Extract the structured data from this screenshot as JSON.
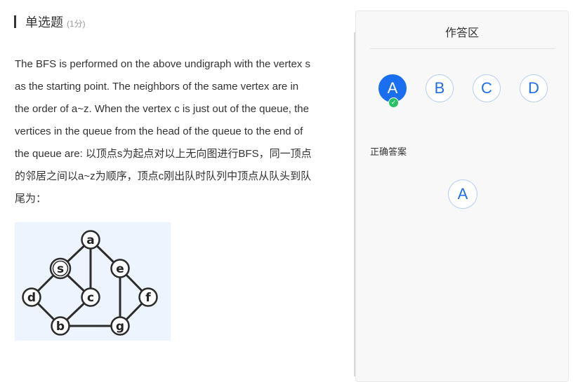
{
  "question": {
    "type": "单选题",
    "score": "(1分)",
    "stem_lines": [
      "The BFS is performed on the above undigraph with the vertex s",
      "as the starting point. The neighbors of the same vertex are in",
      "the order of a~z. When the vertex c is just out of the queue, the",
      "vertices in the queue from the head of the queue to the end of",
      "the queue are: 以顶点s为起点对以上无向图进行BFS，同一顶点",
      "的邻居之间以a~z为顺序，顶点c刚出队时队列中顶点从队头到队",
      "尾为："
    ]
  },
  "graph": {
    "vertices": {
      "a": "a",
      "s": "s",
      "e": "e",
      "d": "d",
      "c": "c",
      "f": "f",
      "b": "b",
      "g": "g"
    }
  },
  "answer_panel": {
    "title": "作答区",
    "options": [
      "A",
      "B",
      "C",
      "D"
    ],
    "selected": "A",
    "correct_label": "正确答案",
    "correct_answer": "A"
  },
  "colors": {
    "accent": "#1a6ff0",
    "check": "#27c264",
    "figure_bg": "#eef4fd"
  }
}
